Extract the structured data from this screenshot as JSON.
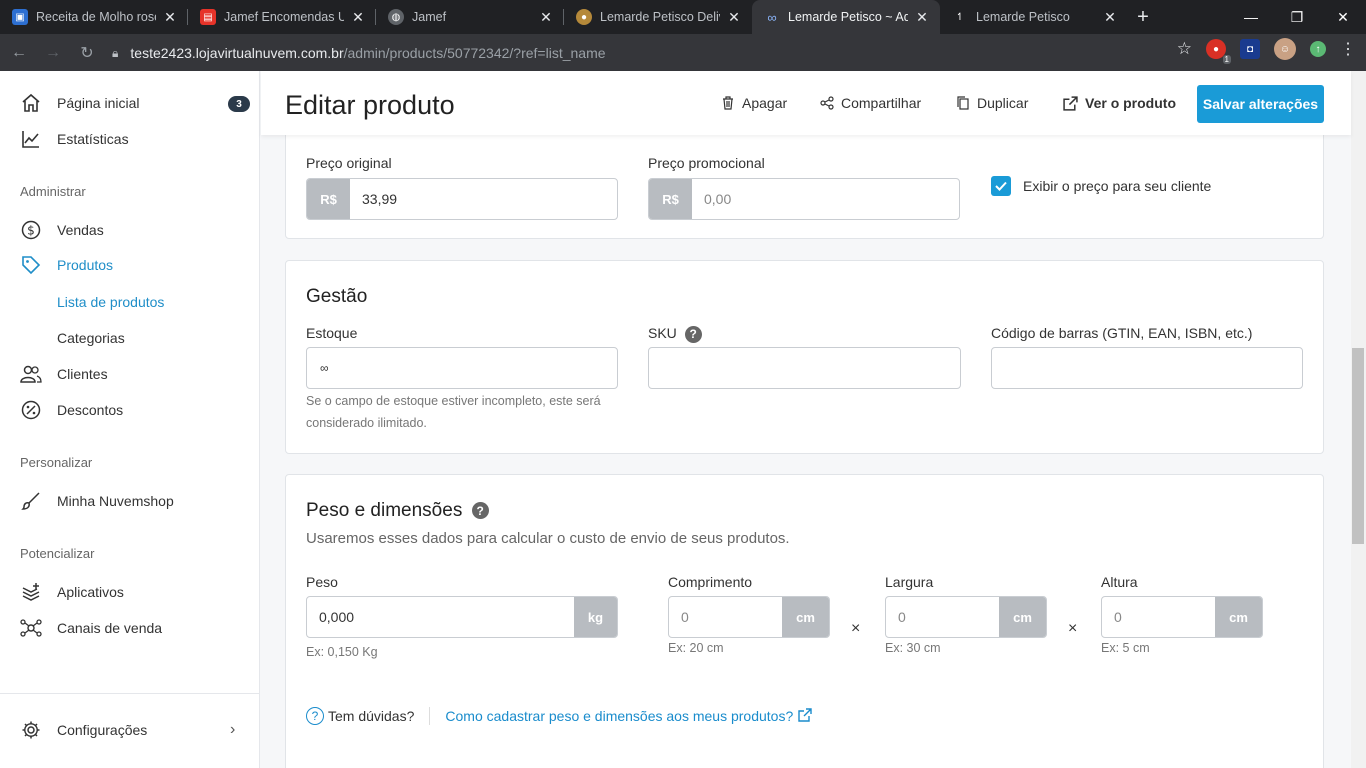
{
  "browser": {
    "tabs": [
      {
        "title": "Receita de Molho rosé",
        "color": "#2d6fd1"
      },
      {
        "title": "Jamef Encomendas Urg",
        "color": "#e63329"
      },
      {
        "title": "Jamef",
        "color": "#5f6368"
      },
      {
        "title": "Lemarde Petisco Delive",
        "color": "#b5893a"
      },
      {
        "title": "Lemarde Petisco ~ Adm",
        "color": "#35363a"
      },
      {
        "title": "Lemarde Petisco",
        "color": "#202124"
      }
    ],
    "url_host": "teste2423.lojavirtualnuvem.com.br",
    "url_path": "/admin/products/50772342/?ref=list_name",
    "ext_badge": "1"
  },
  "sidebar": {
    "home": "Página inicial",
    "home_badge": "3",
    "stats": "Estatísticas",
    "section_admin": "Administrar",
    "sales": "Vendas",
    "products": "Produtos",
    "product_list": "Lista de produtos",
    "categories": "Categorias",
    "customers": "Clientes",
    "discounts": "Descontos",
    "section_customize": "Personalizar",
    "my_store": "Minha Nuvemshop",
    "section_boost": "Potencializar",
    "apps": "Aplicativos",
    "channels": "Canais de venda",
    "settings": "Configurações"
  },
  "header": {
    "title": "Editar produto",
    "delete": "Apagar",
    "share": "Compartilhar",
    "duplicate": "Duplicar",
    "view": "Ver o produto",
    "save": "Salvar alterações"
  },
  "price": {
    "original_label": "Preço original",
    "currency": "R$",
    "original_value": "33,99",
    "promo_label": "Preço promocional",
    "promo_placeholder": "0,00",
    "show_price_label": "Exibir o preço para seu cliente",
    "show_price_checked": true
  },
  "management": {
    "title": "Gestão",
    "stock_label": "Estoque",
    "stock_value": "∞",
    "stock_hint": "Se o campo de estoque estiver incompleto, este será considerado ilimitado.",
    "sku_label": "SKU",
    "barcode_label": "Código de barras (GTIN, EAN, ISBN, etc.)"
  },
  "dimensions": {
    "title": "Peso e dimensões",
    "subtitle": "Usaremos esses dados para calcular o custo de envio de seus produtos.",
    "weight_label": "Peso",
    "weight_value": "0,000",
    "weight_unit": "kg",
    "weight_hint": "Ex: 0,150 Kg",
    "length_label": "Comprimento",
    "length_placeholder": "0",
    "length_hint": "Ex: 20 cm",
    "width_label": "Largura",
    "width_placeholder": "0",
    "width_hint": "Ex: 30 cm",
    "height_label": "Altura",
    "height_placeholder": "0",
    "height_hint": "Ex: 5 cm",
    "unit_cm": "cm",
    "times": "×",
    "help_question": "Tem dúvidas?",
    "help_link": "Como cadastrar peso e dimensões aos meus produtos?"
  }
}
